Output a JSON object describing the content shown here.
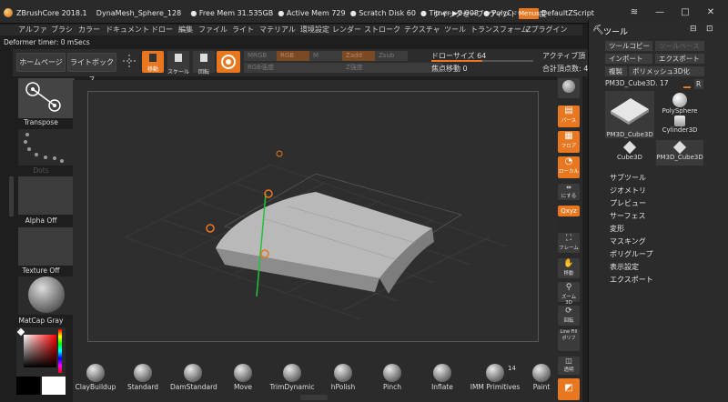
{
  "title_bar": {
    "app_name": "ZBrushCore 2018.1",
    "document": "DynaMesh_Sphere_128",
    "free_mem": "● Free Mem 31.535GB",
    "active_mem": "● Active Mem 729",
    "scratch": "● Scratch Disk 60",
    "timer": "● Timer ▶0.008",
    "poly": "● PolyC",
    "quicksave": "クイックセーブ",
    "transparency": "ウィンドウ透明度",
    "menus": "Menus",
    "default_script": "DefaultZScript",
    "ctrl_icons": [
      "≋",
      "—",
      "□",
      "✕"
    ]
  },
  "menu_bar": [
    "アルファ",
    "ブラシ",
    "カラー",
    "ドキュメント",
    "ドロー",
    "編集",
    "ファイル",
    "ライト",
    "マテリアル",
    "環境設定",
    "レンダー",
    "ストローク",
    "テクスチャ",
    "ツール",
    "トランスフォーム",
    "Zプラグイン"
  ],
  "status": "Deformer timer: 0 mSecs",
  "shelf": {
    "home": "ホームページ",
    "lightbox": "ライトボックス",
    "move": "移動",
    "scale": "スケール",
    "rotate": "回転",
    "mrgb": "MRGB",
    "rgb": "RGB",
    "m": "M",
    "zadd": "Zadd",
    "zsub": "Zsub",
    "rgb_intensity": "RGB強度",
    "z_intensity": "Z強度",
    "draw_size_label": "ドローサイズ",
    "draw_size": "64",
    "draw_size_fraction": 0.5,
    "focal_shift_label": "焦点移動",
    "focal_shift": "0",
    "active_points_label": "アクティブ頂",
    "total_points_label": "合計頂点数: 4"
  },
  "left": {
    "transpose": "Transpose",
    "dots": "Dots",
    "alpha": "Alpha Off",
    "texture": "Texture Off",
    "matcap": "MatCap Gray"
  },
  "brushes": [
    {
      "name": "ClayBuildup"
    },
    {
      "name": "Standard"
    },
    {
      "name": "DamStandard"
    },
    {
      "name": "Move"
    },
    {
      "name": "TrimDynamic"
    },
    {
      "name": "hPolish"
    },
    {
      "name": "Pinch"
    },
    {
      "name": "Inflate"
    },
    {
      "name": "IMM Primitives"
    },
    {
      "name": "Paint"
    }
  ],
  "brush_count": "14",
  "right_strip": [
    "パース",
    "フロア",
    "ローカル",
    "にする",
    "Qxyz",
    "フレーム",
    "移動",
    "ズーム3D",
    "回転",
    "Line Fill ポリフ",
    "透明"
  ],
  "tool_panel": {
    "title": "ツール",
    "copy_tool": "ツールコピー",
    "paste_tool": "ツールペースト",
    "import": "インポート",
    "export": "エクスポート",
    "clone": "複製",
    "polymesh": "ポリメッシュ3D化",
    "current_tool": "PM3D_Cube3D. 17",
    "r_button": "R",
    "thumbs": [
      "PM3D_Cube3D",
      "PolySphere",
      "Cylinder3D",
      "Cube3D",
      "PM3D_Cube3D"
    ],
    "subpalettes": [
      "サブツール",
      "ジオメトリ",
      "プレビュー",
      "サーフェス",
      "変形",
      "マスキング",
      "ポリグループ",
      "表示設定",
      "エクスポート"
    ]
  },
  "colors": {
    "accent": "#e9771f",
    "background": "#2b2b2b"
  }
}
